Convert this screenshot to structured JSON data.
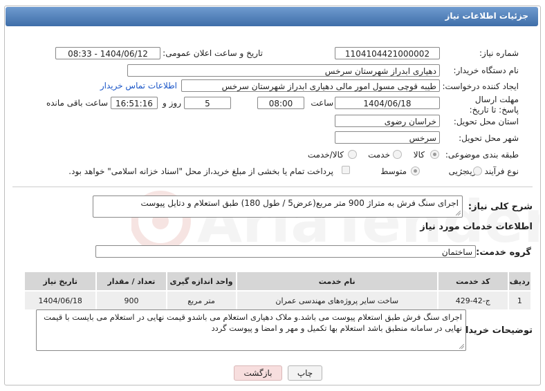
{
  "header": {
    "title": "جزئیات اطلاعات نیاز"
  },
  "fields": {
    "need_number_label": "شماره نیاز:",
    "need_number": "1104104421000002",
    "announce_label": "تاریخ و ساعت اعلان عمومی:",
    "announce_value": "1404/06/12 - 08:33",
    "buyer_org_label": "نام دستگاه خریدار:",
    "buyer_org": "دهیاری ابدراز شهرستان سرخس",
    "creator_label": "ایجاد کننده درخواست:",
    "creator": "طیبه قوچی مسول امور مالی دهیاری ابدراز شهرستان سرخس",
    "contact_link": "اطلاعات تماس خریدار",
    "deadline_label": "مهلت ارسال پاسخ: تا تاریخ:",
    "deadline_date": "1404/06/18",
    "time_label": "ساعت",
    "deadline_time": "08:00",
    "days": "5",
    "days_label": "روز و",
    "remaining": "16:51:16",
    "remaining_label": "ساعت باقی مانده",
    "province_label": "استان محل تحویل:",
    "province": "خراسان رضوی",
    "city_label": "شهر محل تحویل:",
    "city": "سرخس",
    "category_label": "طبقه بندی موضوعی:",
    "cat_goods": "کالا",
    "cat_service": "خدمت",
    "cat_both": "کالا/خدمت",
    "purchase_label": "نوع فرآیند خرید :",
    "proc_partial": "جزیی",
    "proc_medium": "متوسط",
    "payment_note": "پرداخت تمام یا بخشی از مبلغ خرید،از محل \"اسناد خزانه اسلامی\" خواهد بود."
  },
  "summary": {
    "label": "شرح کلی نیاز:",
    "text": "اجرای سنگ فرش به متراژ 900 متر مربع(عرض5 / طول 180) طبق استعلام و دتایل پیوست"
  },
  "services": {
    "section_title": "اطلاعات خدمات مورد نیاز",
    "group_label": "گروه خدمت:",
    "group_value": "ساختمان",
    "columns": [
      "ردیف",
      "کد خدمت",
      "نام خدمت",
      "واحد اندازه گیری",
      "تعداد / مقدار",
      "تاریخ نیاز"
    ],
    "rows": [
      [
        "1",
        "ج-42-429",
        "ساخت سایر پروژه‌های مهندسی عمران",
        "متر مربع",
        "900",
        "1404/06/18"
      ]
    ]
  },
  "buyer_notes": {
    "label": "توضیحات خریدار:",
    "text": "اجرای سنگ فرش طبق استعلام  پیوست می باشد.و ملاک  دهیاری استعلام  می باشدو قیمت نهایی در استعلام می بایست با قیمت  نهایی در سامانه  منطبق باشد استعلام  بها  تکمیل  و مهر و امضا و پیوست  گردد"
  },
  "buttons": {
    "print": "چاپ",
    "back": "بازگشت"
  },
  "watermark": {
    "brand": "AriaTender.net"
  },
  "colors": {
    "header_start": "#6f9bcf",
    "header_end": "#3f6ea9",
    "link": "#1a56c8",
    "back_button": "#f7dede"
  }
}
